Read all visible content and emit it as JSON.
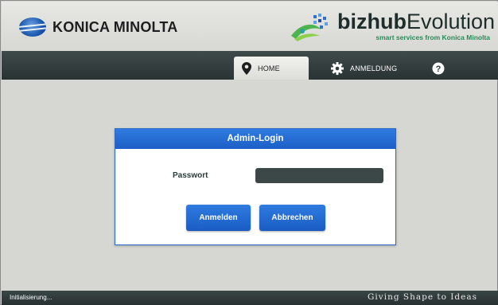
{
  "header": {
    "brand": "KONICA MINOLTA",
    "product_bold": "bizhub",
    "product_light": "Evolution",
    "tagline": "smart services from Konica Minolta"
  },
  "nav": {
    "tabs": [
      {
        "label": "HOME",
        "icon": "location-pin-icon",
        "active": true
      },
      {
        "label": "ANMELDUNG",
        "icon": "gear-icon",
        "active": false
      },
      {
        "label": "",
        "icon": "help-icon",
        "active": false
      }
    ]
  },
  "dialog": {
    "title": "Admin-Login",
    "password_label": "Passwort",
    "password_value": "",
    "login_button": "Anmelden",
    "cancel_button": "Abbrechen"
  },
  "footer": {
    "status": "Initialisierung...",
    "slogan": "Giving Shape to Ideas"
  },
  "colors": {
    "accent_blue": "#1f63cc",
    "navbar": "#2f3939",
    "background": "#d6d7d2",
    "tagline_green": "#2a8a5a"
  }
}
